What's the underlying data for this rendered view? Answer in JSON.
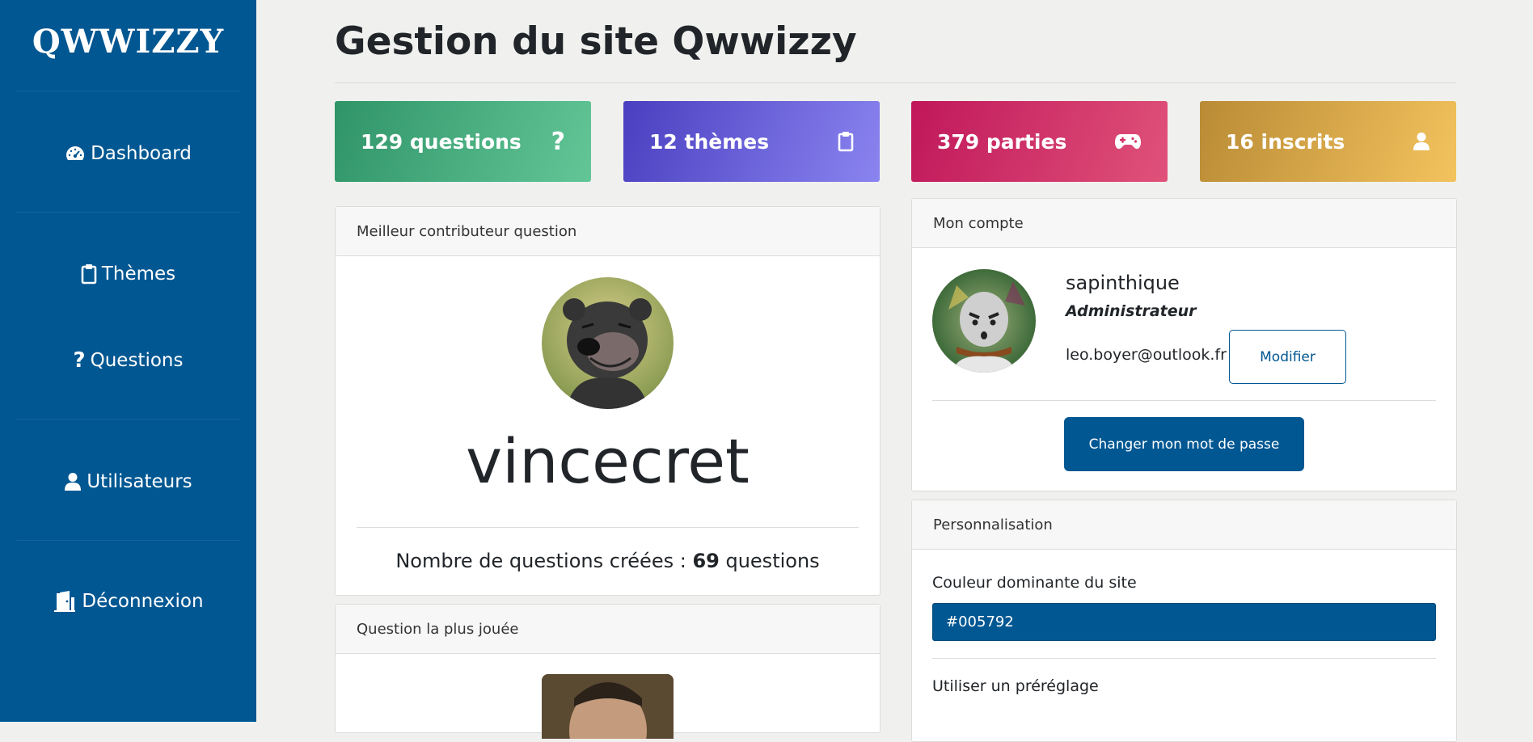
{
  "sidebar": {
    "logo": "QWWIZZY",
    "items": [
      {
        "label": "Dashboard",
        "icon": "dashboard-gauge-icon"
      },
      {
        "label": "Thèmes",
        "icon": "clipboard-icon"
      },
      {
        "label": "Questions",
        "icon": "question-mark-icon"
      },
      {
        "label": "Utilisateurs",
        "icon": "user-icon"
      },
      {
        "label": "Déconnexion",
        "icon": "door-exit-icon"
      }
    ]
  },
  "page": {
    "title": "Gestion du site Qwwizzy"
  },
  "stats": [
    {
      "label": "129 questions",
      "icon": "question-mark-icon",
      "color_from": "#2f9468",
      "color_to": "#62c697"
    },
    {
      "label": "12 thèmes",
      "icon": "clipboard-icon",
      "color_from": "#4a3fc0",
      "color_to": "#8a84f0"
    },
    {
      "label": "379 parties",
      "icon": "gamepad-icon",
      "color_from": "#c0175a",
      "color_to": "#e0527a"
    },
    {
      "label": "16 inscrits",
      "icon": "user-icon",
      "color_from": "#b98b35",
      "color_to": "#f3c35e"
    }
  ],
  "best_contributor": {
    "header": "Meilleur contributeur question",
    "username": "vincecret",
    "count_prefix": "Nombre de questions créées : ",
    "count": "69",
    "count_suffix": " questions"
  },
  "most_played": {
    "header": "Question la plus jouée"
  },
  "account": {
    "header": "Mon compte",
    "username": "sapinthique",
    "role": "Administrateur",
    "email": "leo.boyer@outlook.fr",
    "edit_label": "Modifier",
    "change_password_label": "Changer mon mot de passe"
  },
  "customization": {
    "header": "Personnalisation",
    "color_label": "Couleur dominante du site",
    "color_value": "#005792",
    "preset_label": "Utiliser un préréglage"
  },
  "colors": {
    "accent": "#005792",
    "background": "#f0f1ee"
  }
}
